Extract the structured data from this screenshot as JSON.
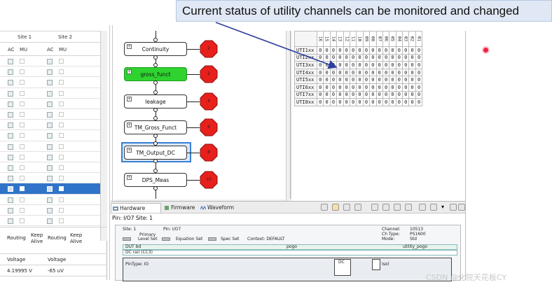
{
  "callout": {
    "text": "Current status of utility channels can be monitored and changed"
  },
  "left_panel": {
    "site1": "Site 1",
    "site2": "Site 2",
    "col_ac": "AC",
    "col_mu": "MU",
    "routing_label": "Routing",
    "keep_alive_label": "Keep Alive",
    "voltage_label": "Voltage",
    "voltage_site1": "4.19995 V",
    "voltage_site2": "-65 uV"
  },
  "flow": {
    "nodes": [
      {
        "label": "Continuity",
        "bin": "2",
        "style": "normal"
      },
      {
        "label": "gross_funct",
        "bin": "2",
        "style": "green"
      },
      {
        "label": "leakage",
        "bin": "4",
        "style": "normal"
      },
      {
        "label": "TM_Gross_Funct",
        "bin": "6",
        "style": "normal"
      },
      {
        "label": "TM_Output_DC",
        "bin": "8",
        "style": "selected"
      },
      {
        "label": "DPS_Meas",
        "bin": "10",
        "style": "normal"
      }
    ],
    "plus": "+"
  },
  "grid": {
    "columns": [
      "16",
      "15",
      "14",
      "13",
      "12",
      "11",
      "10",
      "09",
      "08",
      "07",
      "06",
      "05",
      "04",
      "03",
      "02",
      "01"
    ],
    "rows": [
      {
        "label": "UTI1xx",
        "values": [
          "0",
          "0",
          "0",
          "0",
          "0",
          "0",
          "0",
          "0",
          "0",
          "0",
          "0",
          "0",
          "0",
          "0",
          "0",
          "0"
        ]
      },
      {
        "label": "UTI2xx",
        "values": [
          "0",
          "0",
          "0",
          "0",
          "0",
          "0",
          "0",
          "0",
          "0",
          "0",
          "0",
          "0",
          "0",
          "0",
          "0",
          "0"
        ]
      },
      {
        "label": "UTI3xx",
        "values": [
          "0",
          "0",
          "0",
          "0",
          "0",
          "0",
          "0",
          "0",
          "0",
          "0",
          "0",
          "0",
          "0",
          "0",
          "0",
          "0"
        ]
      },
      {
        "label": "UTI4xx",
        "values": [
          "0",
          "0",
          "0",
          "0",
          "0",
          "0",
          "0",
          "0",
          "0",
          "0",
          "0",
          "0",
          "0",
          "0",
          "0",
          "0"
        ]
      },
      {
        "label": "UTI5xx",
        "values": [
          "0",
          "0",
          "0",
          "0",
          "0",
          "0",
          "0",
          "0",
          "0",
          "0",
          "0",
          "0",
          "0",
          "0",
          "0",
          "0"
        ]
      },
      {
        "label": "UTI6xx",
        "values": [
          "0",
          "0",
          "0",
          "0",
          "0",
          "0",
          "0",
          "0",
          "0",
          "0",
          "0",
          "0",
          "0",
          "0",
          "0",
          "0"
        ]
      },
      {
        "label": "UTI7xx",
        "values": [
          "0",
          "0",
          "0",
          "0",
          "0",
          "0",
          "0",
          "0",
          "0",
          "0",
          "0",
          "0",
          "0",
          "0",
          "0",
          "0"
        ]
      },
      {
        "label": "UTI8xx",
        "values": [
          "0",
          "0",
          "0",
          "0",
          "0",
          "0",
          "0",
          "0",
          "0",
          "0",
          "0",
          "0",
          "0",
          "0",
          "0",
          "0"
        ]
      }
    ]
  },
  "hardware": {
    "tabs": [
      "Hardware",
      "Firmware",
      "Waveform"
    ],
    "pin_line": "Pin: I/O7  Site: 1",
    "site": "Site:  1",
    "pin": "Pin:  I/O7",
    "primary": "Primary",
    "level_set": "Level Set",
    "equation_set": "Equation Set",
    "spec_set": "Spec Set",
    "context": "Context:  DEFAULT",
    "channel_label": "Channel:",
    "channel_value": "10513",
    "chtype_label": "Ch Type:",
    "chtype_value": "PS1600",
    "mode_label": "Mode:",
    "mode_value": "Std",
    "dut_bd": "DUT bd",
    "dc_rail": "DC rail (CC3)",
    "pogo": "pogo",
    "utility_pogo": "utility_pogo",
    "pintype": "PinType: IO",
    "dc": "DC",
    "isol": "Isol"
  },
  "watermark": "CSDN @化院天花板CY"
}
